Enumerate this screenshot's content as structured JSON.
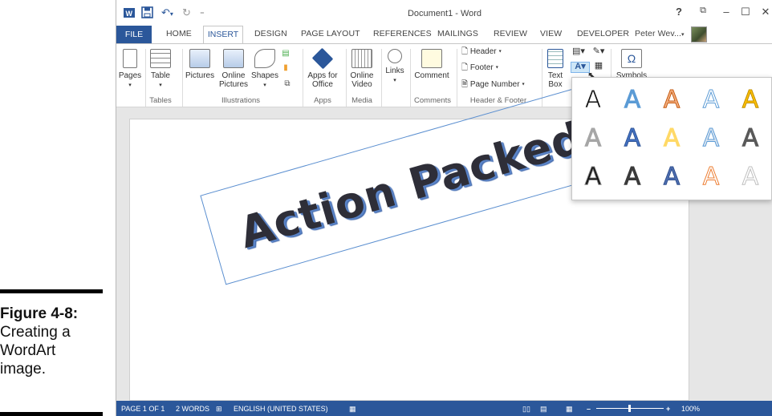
{
  "caption": {
    "label": "Figure 4-8:",
    "text": "Creating a WordArt image."
  },
  "window": {
    "title": "Document1 - Word",
    "help": "?",
    "user": "Peter Wev...",
    "controls": {
      "restore": "⧉",
      "minimize": "–",
      "maximize": "☐",
      "close": "✕"
    }
  },
  "tabs": {
    "file": "FILE",
    "home": "HOME",
    "insert": "INSERT",
    "design": "DESIGN",
    "page_layout": "PAGE LAYOUT",
    "references": "REFERENCES",
    "mailings": "MAILINGS",
    "review": "REVIEW",
    "view": "VIEW",
    "developer": "DEVELOPER"
  },
  "ribbon": {
    "pages": "Pages",
    "table": "Table",
    "pictures": "Pictures",
    "online_pictures_1": "Online",
    "online_pictures_2": "Pictures",
    "shapes": "Shapes",
    "apps_1": "Apps for",
    "apps_2": "Office",
    "online_video_1": "Online",
    "online_video_2": "Video",
    "links": "Links",
    "comment": "Comment",
    "header": "Header",
    "footer": "Footer",
    "page_number": "Page Number",
    "text_box_1": "Text",
    "text_box_2": "Box",
    "symbols": "Symbols",
    "groups": {
      "tables": "Tables",
      "illustrations": "Illustrations",
      "apps": "Apps",
      "media": "Media",
      "comments": "Comments",
      "header_footer": "Header & Footer"
    }
  },
  "wordart": {
    "text": "Action Packed!"
  },
  "gallery": {
    "styles": [
      {
        "glyph": "A",
        "fill": "#111111",
        "stroke": "#ffffff"
      },
      {
        "glyph": "A",
        "fill": "#5b9bd5",
        "stroke": "#5b9bd5"
      },
      {
        "glyph": "A",
        "fill": "#f4b183",
        "stroke": "#c55a11"
      },
      {
        "glyph": "A",
        "fill": "#ffffff",
        "stroke": "#5b9bd5"
      },
      {
        "glyph": "A",
        "fill": "#ffc000",
        "stroke": "#bf8f00"
      },
      {
        "glyph": "A",
        "fill": "#a6a6a6",
        "stroke": "#a6a6a6"
      },
      {
        "glyph": "A",
        "fill": "#4472c4",
        "stroke": "#2f5597"
      },
      {
        "glyph": "A",
        "fill": "#ffd966",
        "stroke": "#ffd966"
      },
      {
        "glyph": "A",
        "fill": "#dbe5f1",
        "stroke": "#5b9bd5"
      },
      {
        "glyph": "A",
        "fill": "#595959",
        "stroke": "#595959"
      },
      {
        "glyph": "A",
        "fill": "#111111",
        "stroke": "#7f7f7f"
      },
      {
        "glyph": "A",
        "fill": "#3a3a3a",
        "stroke": "#3a3a3a"
      },
      {
        "glyph": "A",
        "fill": "#4f6fb0",
        "stroke": "#2f4f8f"
      },
      {
        "glyph": "A",
        "fill": "#ffffff",
        "stroke": "#ed7d31"
      },
      {
        "glyph": "A",
        "fill": "#ffffff",
        "stroke": "#bfbfbf"
      }
    ]
  },
  "status": {
    "page": "PAGE 1 OF 1",
    "words": "2 WORDS",
    "language": "ENGLISH (UNITED STATES)",
    "zoom": "100%"
  },
  "colors": {
    "accent": "#2b579a",
    "wordart_shadow": "#5a84c8"
  }
}
